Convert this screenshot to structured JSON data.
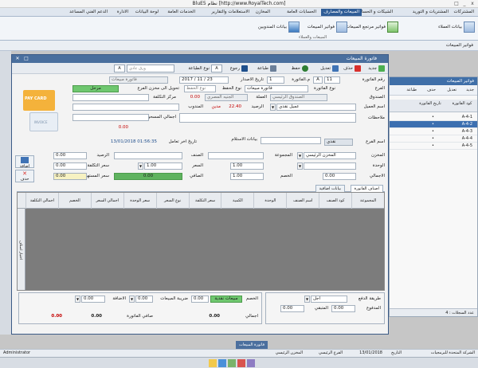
{
  "app": {
    "title": "BluE5 نظام [http://www.RoyalTech.com]",
    "win_min": "_",
    "win_max": "□",
    "win_close": "x"
  },
  "ribbon_tabs": [
    "المشتركات",
    "المشتريات و التوريد",
    "الشيكات و الحسابات",
    "المبيعات والمصارف",
    "الحسابات العامة",
    "المخازن",
    "الاستعلامات والتقارير",
    "الخدمات العامة",
    "لوحة البيانات",
    "الادارة",
    "الدعم الفني المساعد"
  ],
  "ribbon_active_index": 3,
  "ribbon_buttons": [
    {
      "label": "بيانات العملاء",
      "icon": "customers-icon"
    },
    {
      "label": "فواتير مرتجع المبيعات",
      "icon": "return-invoice-icon"
    },
    {
      "label": "فواتير المبيعات",
      "icon": "sales-invoice-icon"
    },
    {
      "label": "بيانات المندوبين",
      "icon": "reps-icon"
    }
  ],
  "ribbon_group_label": "المبيعات والعملاء",
  "subbar": {
    "title": "فواتير المبيعات"
  },
  "modal": {
    "title": "فاتورة المبيعات",
    "toolbar": {
      "new": "جديد",
      "delete": "حذف",
      "modify": "تعديل",
      "save": "حفظ",
      "print": "طباعة",
      "back": "رجوع",
      "search_prefix": "طباعة",
      "print_type": "نوع الطباعة",
      "print_type_value": "A",
      "paper": "ورق عادي",
      "paper_dropdown": "A"
    },
    "header": {
      "invoice_no_label": "رقم الفاتورة",
      "invoice_no": "11",
      "code_label": "A",
      "mandob_no_label": "م.الفاتورة",
      "mandob_no": "1",
      "date_label": "تاريخ الاصدار",
      "date_value": "2017 / 11 / 23",
      "time_label": "نوع الحفظ",
      "time_value": "نوع الحفظ",
      "invoice_type_label": "نوع الفاتورة",
      "invoice_type": "فاتورة مبيعات",
      "branch_label": "الفرع",
      "currency_label": "العملة",
      "currency": "الجنيه المصري",
      "account_label": "الصندوق",
      "account": "الصندوق الرئيسي",
      "cost_center_label": "مركز التكلفة",
      "cost_center_value": "0.00",
      "customer_label": "اسم العميل",
      "customer": "عميل نقدي",
      "balance_label": "الرصيد",
      "balance": "22.40",
      "balance_type": "مدين",
      "notes_label": "ملاحظات",
      "mandob_label": "المندوب",
      "cash_label": "اسم الفرع",
      "cash_toggle": "نقدي",
      "extra_label": "بيانات الاستلام",
      "last_date_label": "تاريخ اخر تعامل",
      "last_date": "13/01/2018 01:56:35",
      "transfer_label": "تحويل الى مخزن الفرع",
      "total_label": "اجمالي المسحوب",
      "total_value": "0.00",
      "status_pill": "مرحل",
      "remaining_label": "حد الائتمان"
    },
    "item": {
      "store_label": "المخزن",
      "store_value": "المخزن الرئيسي",
      "group_label": "المجموعة",
      "item_label": "الصنف",
      "balance_label": "الرصيد",
      "balance_value": "0.00",
      "unit_label": "الوحدة",
      "price_label": "السعر",
      "price_value": "0.00",
      "qty_label": "الكمية",
      "qty_value": "1.00",
      "cost_label": "سعر التكلفة",
      "cost_value": "0.00",
      "total_label": "الاجمالي",
      "total_value": "0.00",
      "discount_label": "الخصم",
      "discount_value": "0.00",
      "net_label": "الصافي",
      "net_value": "0.00",
      "consumer_label": "سعر المستهلك",
      "consumer_value": "0.00",
      "add_btn": "اضافة",
      "delete_btn": "حذف",
      "extra_qty": "1.00"
    },
    "tabs": [
      "اصناف الفاتورة",
      "بيانات اضافية"
    ],
    "grid_columns": [
      "المجموعة",
      "كود الصنف",
      "اسم الصنف",
      "الوحدة",
      "الكمية",
      "سعر التكلفة",
      "نوع السعر",
      "سعر الوحدة",
      "اجمالي السعر",
      "الخصم",
      "اجمالي التكلفة"
    ],
    "grid_side_label": "اختيار اصناف",
    "totals": {
      "payment_label": "طريقة الدفع",
      "payment_value": "اجل",
      "paid_label": "المدفوع",
      "paid_value": "0.00",
      "remaining_label": "المتبقي",
      "remaining_value": "0.00",
      "discount_label": "الخصم",
      "discount_type": "قيمة / نسبة",
      "discount_value": "0.00",
      "tax_label": "ضريبة المبيعات",
      "tax_value": "0.00",
      "added_label": "الاضافة",
      "added_value": "0.00",
      "total_label": "اجمالي",
      "total_value": "0.00",
      "net_label": "صافي الفاتورة",
      "net_value": "0.00",
      "final_value": "0.00",
      "status_pill": "مبيعات نقدية"
    }
  },
  "side_panel": {
    "title": "فواتير المبيعات",
    "toolbar": [
      "جديد",
      "تعديل",
      "حذف",
      "طباعة"
    ],
    "col_code": "كود الفاتورة",
    "col_date": "تاريخ الفاتورة",
    "rows": [
      {
        "code": "A-4-1",
        "date": "•"
      },
      {
        "code": "A-4-2",
        "date": "•"
      },
      {
        "code": "A-4-3",
        "date": "•"
      },
      {
        "code": "A-4-4",
        "date": "•"
      },
      {
        "code": "A-4-5",
        "date": "•"
      }
    ],
    "selected_index": 1,
    "footer": "عدد السجلات : 4"
  },
  "bottom_tab": "فاتورة المبيعات",
  "statusbar": {
    "company": "الشركة المتحدة للبرمجيات",
    "date_label": "التاريخ",
    "date": "13/01/2018",
    "branch": "الفرع الرئيسي",
    "store": "المخزن الرئيسي",
    "user": "Administrator"
  },
  "colors": {
    "accent": "#2f5d97",
    "green": "#6fc76f",
    "red": "#c40000",
    "grid_bg": "#7c7c7c"
  }
}
